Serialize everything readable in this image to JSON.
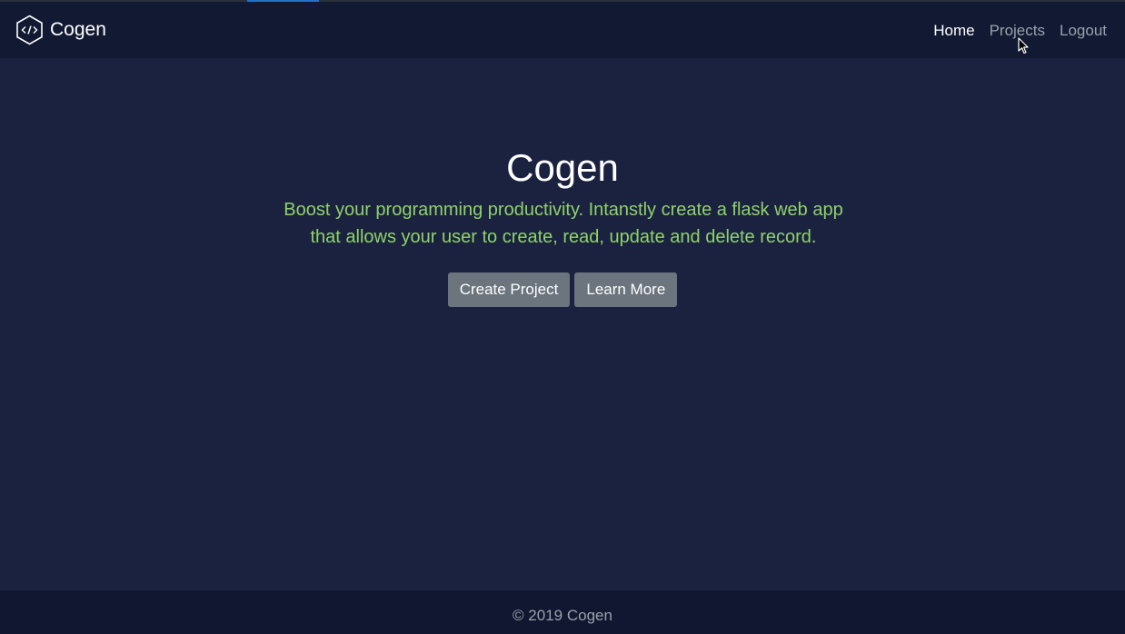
{
  "navbar": {
    "brand": "Cogen",
    "brand_icon": "code-hexagon-icon",
    "links": [
      {
        "label": "Home",
        "active": true
      },
      {
        "label": "Projects",
        "active": false
      },
      {
        "label": "Logout",
        "active": false
      }
    ]
  },
  "hero": {
    "title": "Cogen",
    "lead_line1": "Boost your programming productivity. Intanstly create a flask web app",
    "lead_line2": "that allows your user to create, read, update and delete record.",
    "buttons": {
      "create": "Create Project",
      "learn": "Learn More"
    }
  },
  "footer": {
    "text": "© 2019 Cogen"
  },
  "colors": {
    "page_background": "#1b2240",
    "navbar_background": "#121a33",
    "lead_text": "#8fd26a",
    "button_background": "#6c747e",
    "top_accent": "#1f73c6"
  }
}
